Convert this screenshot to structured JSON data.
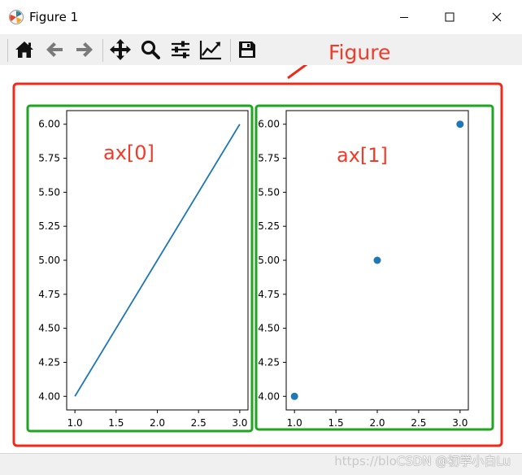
{
  "window": {
    "title": "Figure 1",
    "minimize_icon": "minimize-icon",
    "maximize_icon": "maximize-icon",
    "close_icon": "close-icon"
  },
  "toolbar": {
    "tools": [
      {
        "name": "home",
        "icon": "home-icon"
      },
      {
        "name": "back",
        "icon": "arrow-left-icon"
      },
      {
        "name": "forward",
        "icon": "arrow-right-icon"
      },
      {
        "name": "pan",
        "icon": "move-icon"
      },
      {
        "name": "zoom",
        "icon": "magnifier-icon"
      },
      {
        "name": "configure-subplots",
        "icon": "sliders-icon"
      },
      {
        "name": "edit-axes",
        "icon": "line-chart-icon"
      },
      {
        "name": "save",
        "icon": "floppy-disk-icon"
      }
    ]
  },
  "annotations": {
    "figure_label": "Figure",
    "ax0_label": "ax[0]",
    "ax1_label": "ax[1]",
    "figure_box_color": "#ee2a1b",
    "axes_box_color": "#1fa51f",
    "label_color": "#f03a2a"
  },
  "chart_data": [
    {
      "type": "line",
      "x": [
        1.0,
        2.0,
        3.0
      ],
      "series": [
        {
          "values": [
            4.0,
            5.0,
            6.0
          ],
          "color": "#1f77b4"
        }
      ],
      "xlim": [
        0.9,
        3.1
      ],
      "ylim": [
        3.9,
        6.1
      ],
      "xticks": [
        1.0,
        1.5,
        2.0,
        2.5,
        3.0
      ],
      "xtick_labels": [
        "1.0",
        "1.5",
        "2.0",
        "2.5",
        "3.0"
      ],
      "yticks": [
        4.0,
        4.25,
        4.5,
        4.75,
        5.0,
        5.25,
        5.5,
        5.75,
        6.0
      ],
      "ytick_labels": [
        "4.00",
        "4.25",
        "4.50",
        "4.75",
        "5.00",
        "5.25",
        "5.50",
        "5.75",
        "6.00"
      ],
      "grid": false
    },
    {
      "type": "scatter",
      "x": [
        1.0,
        2.0,
        3.0
      ],
      "series": [
        {
          "values": [
            4.0,
            5.0,
            6.0
          ],
          "color": "#1f77b4"
        }
      ],
      "xlim": [
        0.9,
        3.1
      ],
      "ylim": [
        3.9,
        6.1
      ],
      "xticks": [
        1.0,
        1.5,
        2.0,
        2.5,
        3.0
      ],
      "xtick_labels": [
        "1.0",
        "1.5",
        "2.0",
        "2.5",
        "3.0"
      ],
      "yticks": [
        4.0,
        4.25,
        4.5,
        4.75,
        5.0,
        5.25,
        5.5,
        5.75,
        6.0
      ],
      "ytick_labels": [
        "4.00",
        "4.25",
        "4.50",
        "4.75",
        "5.00",
        "5.25",
        "5.50",
        "5.75",
        "6.00"
      ],
      "grid": false
    }
  ],
  "status": {
    "watermark_prefix": "https://blo",
    "watermark_text": "CSDN @初学小白Lu"
  }
}
